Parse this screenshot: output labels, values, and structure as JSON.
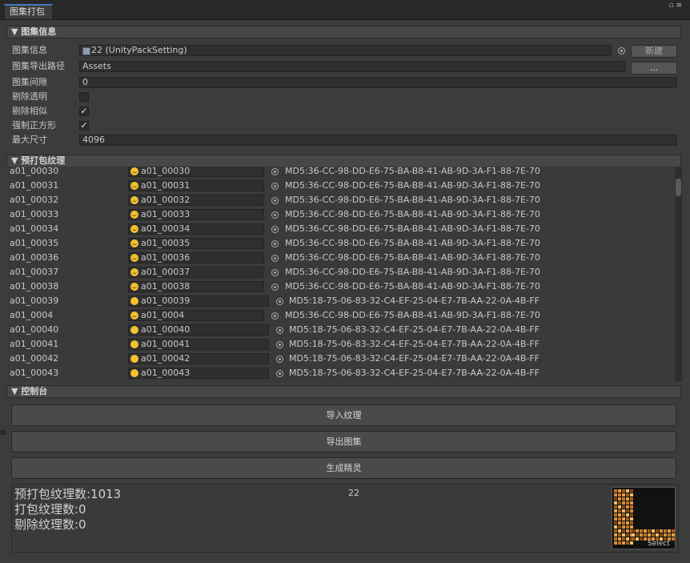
{
  "window": {
    "tab_title": "图集打包",
    "controls_glyph": "▫ ≡"
  },
  "atlas_info": {
    "section_title": "▼ 图集信息",
    "atlas_label": "图集信息",
    "atlas_value": "22 (UnityPackSetting)",
    "new_button": "新建",
    "export_path_label": "图集导出路径",
    "export_path_value": "Assets",
    "browse_button": "...",
    "spacing_label": "图集间隙",
    "spacing_value": "0",
    "remove_alpha_label": "剔除透明",
    "remove_alpha_checked": false,
    "remove_similar_label": "剔除相似",
    "remove_similar_checked": true,
    "force_square_label": "强制正方形",
    "force_square_checked": true,
    "max_size_label": "最大尺寸",
    "max_size_value": "4096",
    "checkmark": "✓"
  },
  "prepack": {
    "section_title": "▼ 预打包纹理",
    "rows": [
      {
        "name": "a01_00030",
        "object": "a01_00030",
        "md5": "MD5:36-CC-98-DD-E6-75-BA-B8-41-AB-9D-3A-F1-88-7E-70",
        "face": "happy"
      },
      {
        "name": "a01_00031",
        "object": "a01_00031",
        "md5": "MD5:36-CC-98-DD-E6-75-BA-B8-41-AB-9D-3A-F1-88-7E-70",
        "face": "happy"
      },
      {
        "name": "a01_00032",
        "object": "a01_00032",
        "md5": "MD5:36-CC-98-DD-E6-75-BA-B8-41-AB-9D-3A-F1-88-7E-70",
        "face": "happy"
      },
      {
        "name": "a01_00033",
        "object": "a01_00033",
        "md5": "MD5:36-CC-98-DD-E6-75-BA-B8-41-AB-9D-3A-F1-88-7E-70",
        "face": "happy"
      },
      {
        "name": "a01_00034",
        "object": "a01_00034",
        "md5": "MD5:36-CC-98-DD-E6-75-BA-B8-41-AB-9D-3A-F1-88-7E-70",
        "face": "happy"
      },
      {
        "name": "a01_00035",
        "object": "a01_00035",
        "md5": "MD5:36-CC-98-DD-E6-75-BA-B8-41-AB-9D-3A-F1-88-7E-70",
        "face": "happy"
      },
      {
        "name": "a01_00036",
        "object": "a01_00036",
        "md5": "MD5:36-CC-98-DD-E6-75-BA-B8-41-AB-9D-3A-F1-88-7E-70",
        "face": "happy"
      },
      {
        "name": "a01_00037",
        "object": "a01_00037",
        "md5": "MD5:36-CC-98-DD-E6-75-BA-B8-41-AB-9D-3A-F1-88-7E-70",
        "face": "happy"
      },
      {
        "name": "a01_00038",
        "object": "a01_00038",
        "md5": "MD5:36-CC-98-DD-E6-75-BA-B8-41-AB-9D-3A-F1-88-7E-70",
        "face": "happy"
      },
      {
        "name": "a01_00039",
        "object": "a01_00039",
        "md5": "MD5:18-75-06-83-32-C4-EF-25-04-E7-7B-AA-22-0A-4B-FF",
        "face": "plain"
      },
      {
        "name": "a01_0004",
        "object": "a01_0004",
        "md5": "MD5:36-CC-98-DD-E6-75-BA-B8-41-AB-9D-3A-F1-88-7E-70",
        "face": "happy"
      },
      {
        "name": "a01_00040",
        "object": "a01_00040",
        "md5": "MD5:18-75-06-83-32-C4-EF-25-04-E7-7B-AA-22-0A-4B-FF",
        "face": "plain"
      },
      {
        "name": "a01_00041",
        "object": "a01_00041",
        "md5": "MD5:18-75-06-83-32-C4-EF-25-04-E7-7B-AA-22-0A-4B-FF",
        "face": "plain"
      },
      {
        "name": "a01_00042",
        "object": "a01_00042",
        "md5": "MD5:18-75-06-83-32-C4-EF-25-04-E7-7B-AA-22-0A-4B-FF",
        "face": "plain"
      },
      {
        "name": "a01_00043",
        "object": "a01_00043",
        "md5": "MD5:18-75-06-83-32-C4-EF-25-04-E7-7B-AA-22-0A-4B-FF",
        "face": "plain"
      }
    ]
  },
  "console": {
    "section_title": "▼ 控制台",
    "import_button": "导入纹理",
    "export_button": "导出图集",
    "sprite_button": "生成精灵",
    "prepack_count": "预打包纹理数:1013",
    "packed_count": "打包纹理数:0",
    "removed_count": "剔除纹理数:0",
    "atlas_name": "22",
    "preview_select": "Select"
  }
}
